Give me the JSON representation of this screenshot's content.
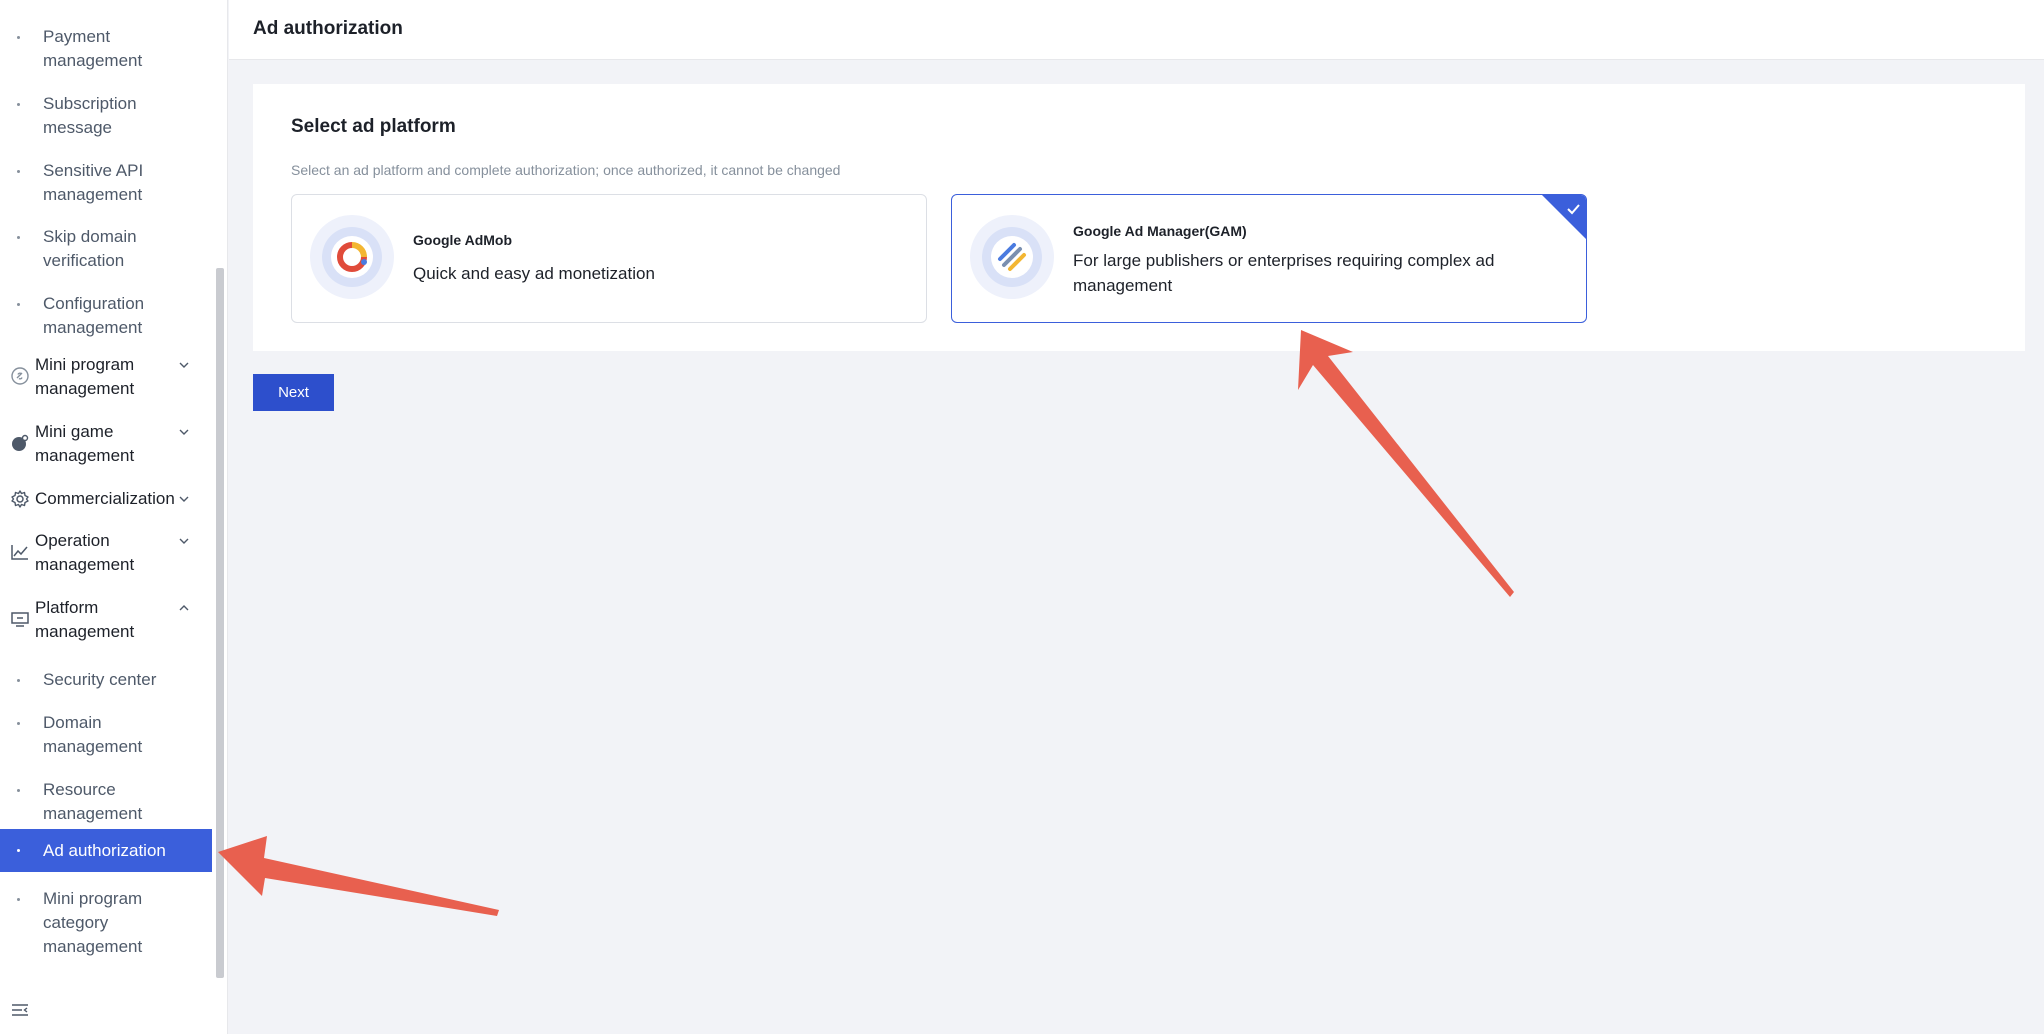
{
  "sidebar": {
    "top_items": [
      {
        "label": "Payment management"
      },
      {
        "label": "Subscription message"
      },
      {
        "label": "Sensitive API management"
      },
      {
        "label": "Skip domain verification"
      },
      {
        "label": "Configuration management"
      }
    ],
    "groups": [
      {
        "label": "Mini program management",
        "icon": "link-icon"
      },
      {
        "label": "Mini game management",
        "icon": "game-icon"
      },
      {
        "label": "Commercialization",
        "icon": "gear-icon"
      },
      {
        "label": "Operation management",
        "icon": "chart-icon"
      },
      {
        "label": "Platform management",
        "icon": "monitor-icon"
      }
    ],
    "platform_items": [
      {
        "label": "Security center"
      },
      {
        "label": "Domain management"
      },
      {
        "label": "Resource management"
      },
      {
        "label": "Ad authorization",
        "active": true
      },
      {
        "label": "Mini program category management"
      }
    ]
  },
  "header": {
    "title": "Ad authorization"
  },
  "main": {
    "section_title": "Select ad platform",
    "description": "Select an ad platform and complete authorization; once authorized, it cannot be changed",
    "cards": [
      {
        "name": "Google AdMob",
        "desc": "Quick and easy ad monetization",
        "selected": false
      },
      {
        "name": "Google Ad Manager(GAM)",
        "desc": "For large publishers or enterprises requiring complex ad management",
        "selected": true
      }
    ],
    "next_label": "Next"
  },
  "colors": {
    "accent": "#3b5fdb",
    "annotation_arrow": "#e8604f"
  }
}
